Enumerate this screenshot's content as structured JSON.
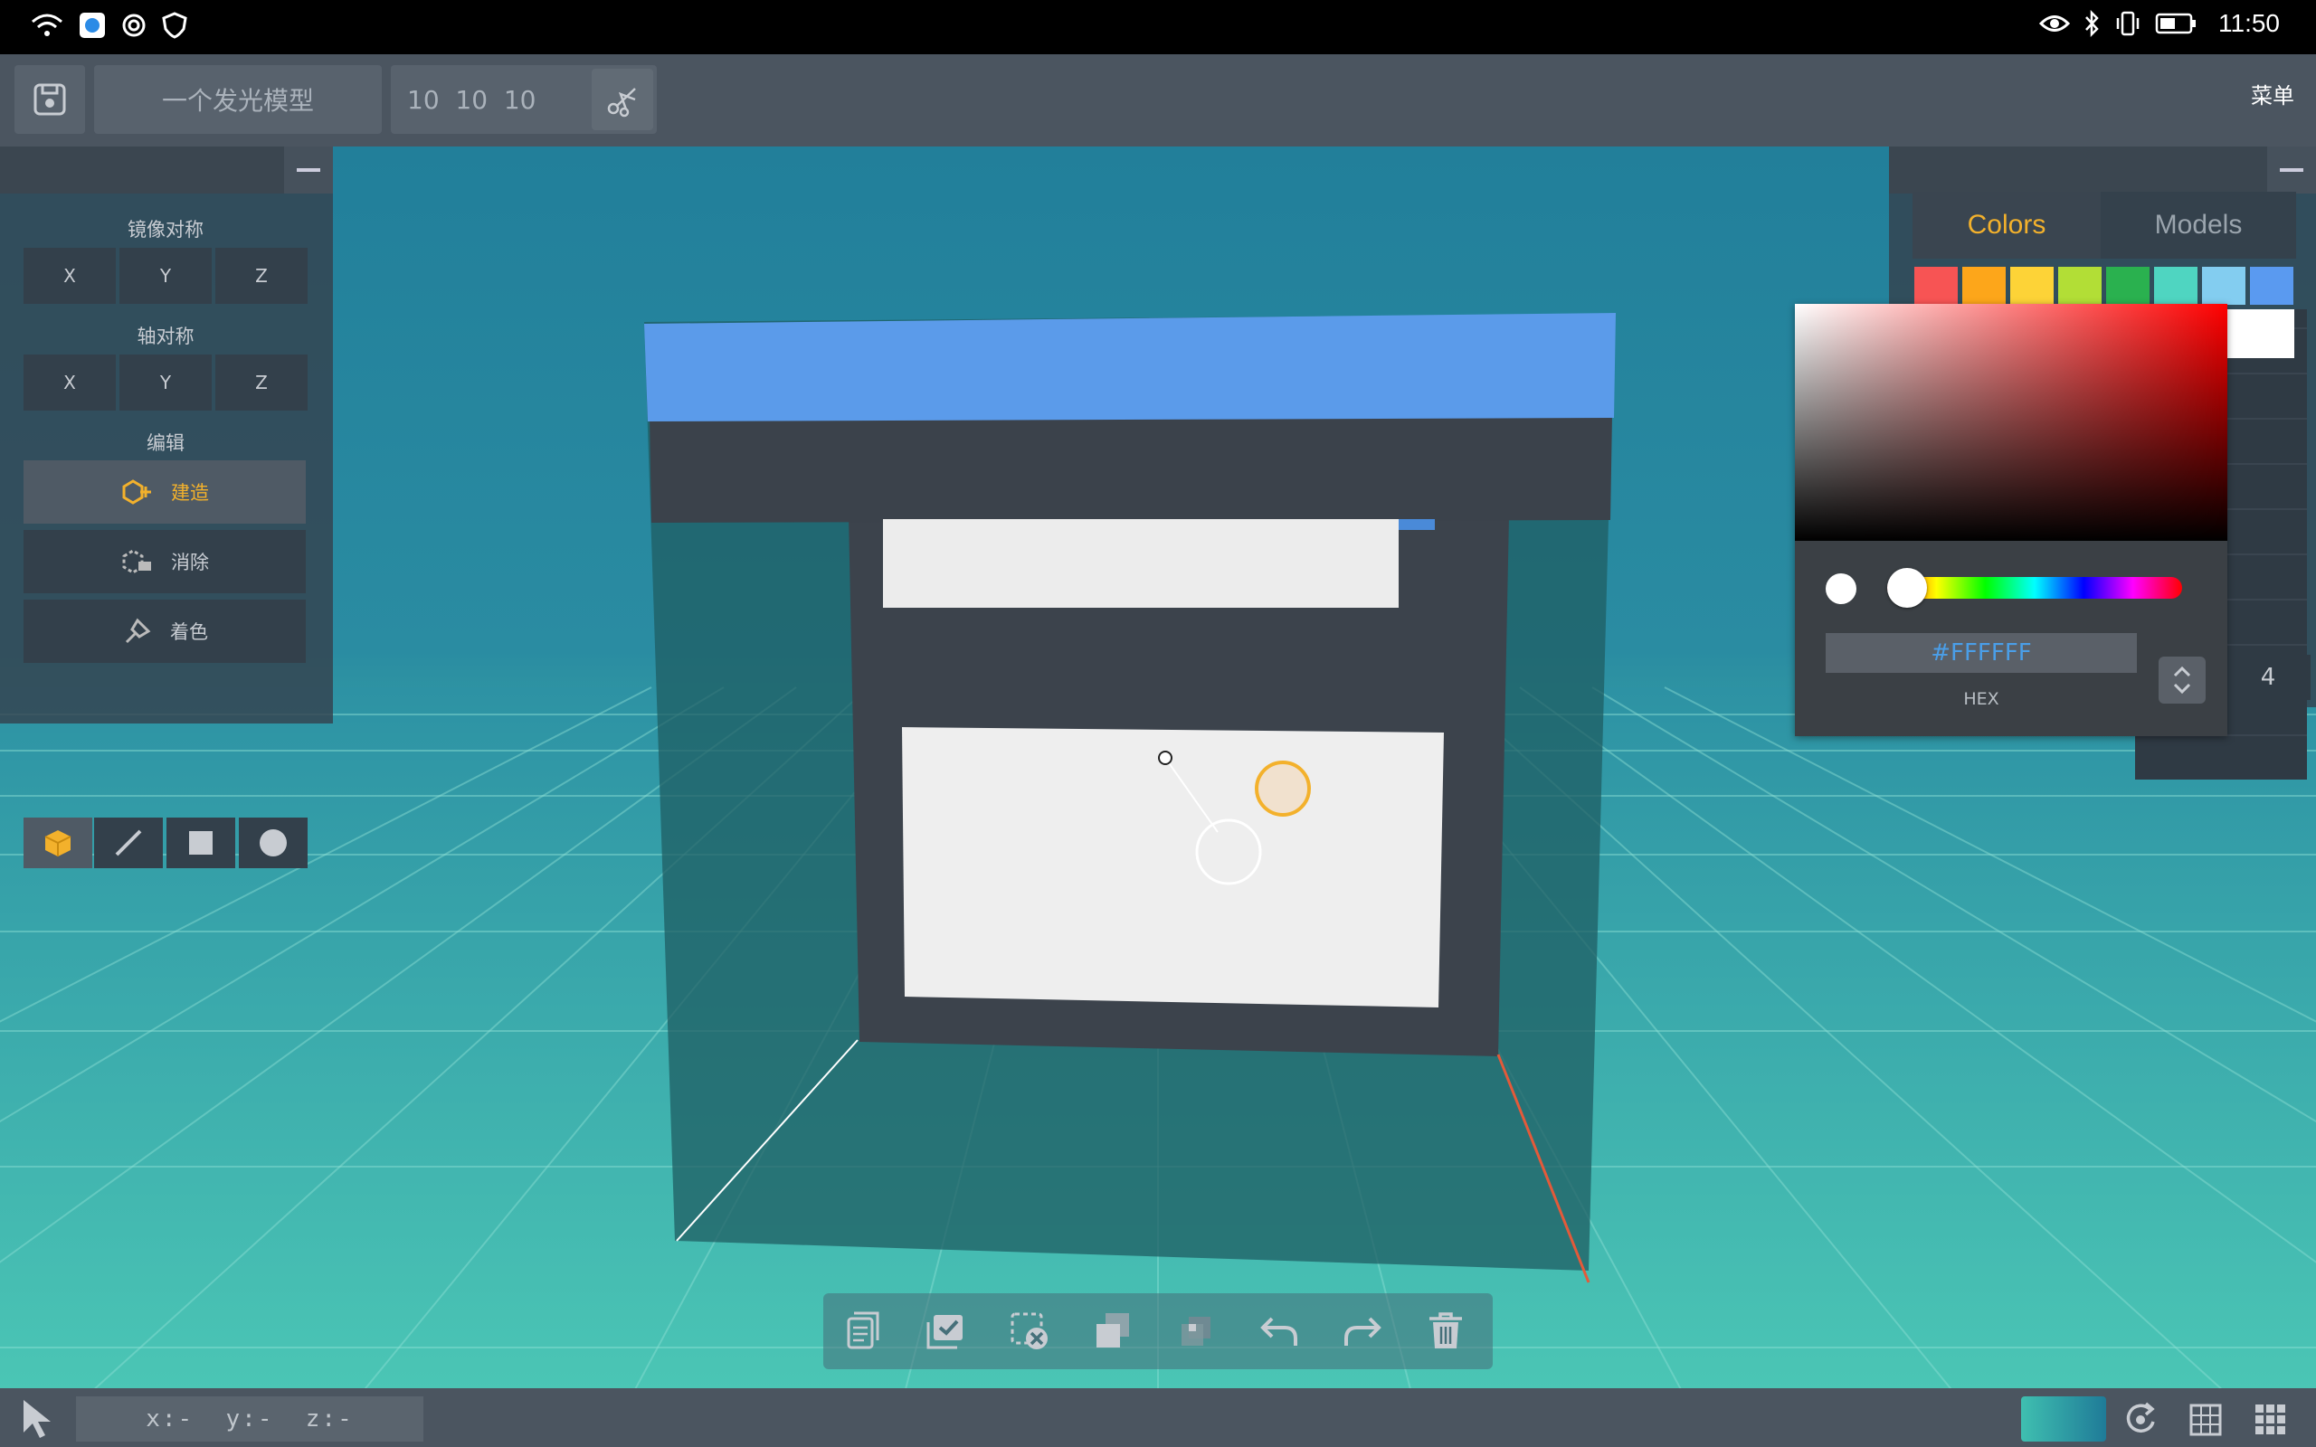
{
  "status_bar": {
    "time": "11:50"
  },
  "toolbar": {
    "model_name": "一个发光模型",
    "dimensions": "10  10  10",
    "menu_label": "菜单"
  },
  "left_panel": {
    "mirror_label": "镜像对称",
    "mirror_axes": [
      "X",
      "Y",
      "Z"
    ],
    "axis_label": "轴对称",
    "axis_axes": [
      "X",
      "Y",
      "Z"
    ],
    "edit_label": "编辑",
    "edit_buttons": {
      "build": "建造",
      "erase": "消除",
      "paint": "着色"
    },
    "active_edit": "build"
  },
  "right_panel": {
    "tabs": {
      "colors": "Colors",
      "models": "Models"
    },
    "active_tab": "colors",
    "palette": [
      "#f75454",
      "#fda61a",
      "#fdd337",
      "#b2de36",
      "#2ab14f",
      "#4fd5c1",
      "#83cdf0",
      "#5a9af0"
    ],
    "selected_swatch_color": "#ffffff",
    "size_value": "4"
  },
  "color_picker": {
    "hex_value": "#FFFFFF",
    "hex_label": "HEX",
    "hue_position": 0.0
  },
  "bottom_bar": {
    "coords": "x:-  y:-  z:-"
  },
  "colors": {
    "accent": "#f3b12c",
    "model_top": "#5b9bea",
    "model_body": "#3c434c",
    "hex_text": "#4a9ee8"
  }
}
